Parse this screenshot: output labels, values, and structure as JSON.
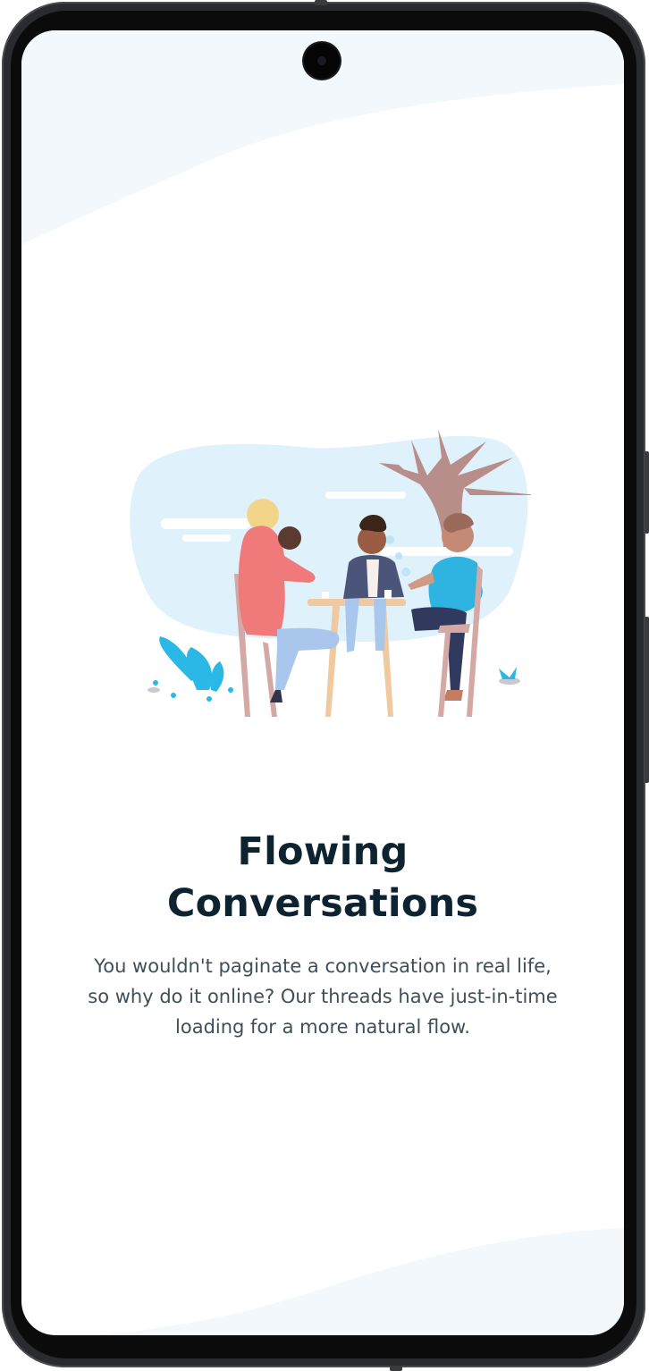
{
  "onboarding": {
    "title": "Flowing Conversations",
    "description": "You wouldn't paginate a conversation in real life, so why do it online? Our threads have just-in-time loading for a more natural flow.",
    "illustration": "people-talking-at-table-illustration"
  },
  "colors": {
    "title": "#0e2330",
    "description": "#3f4f5a",
    "background_wave": "#f3f8fd",
    "accent": "#2ab8e6",
    "sky": "#dff1fb"
  }
}
